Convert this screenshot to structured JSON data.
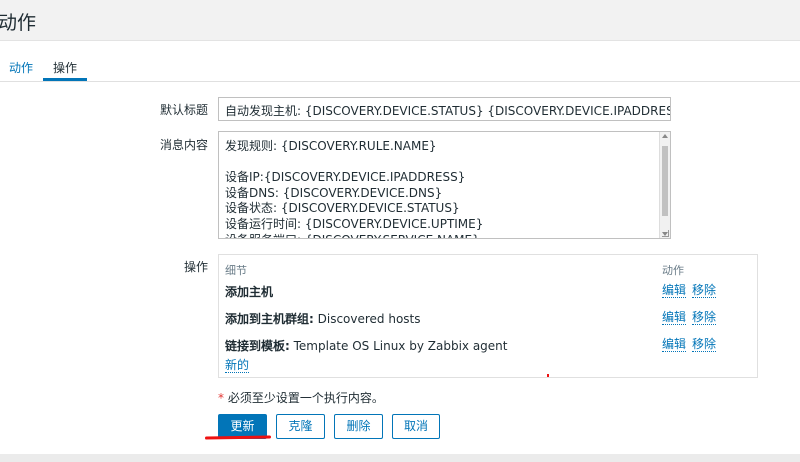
{
  "header": {
    "title": "动作"
  },
  "tabs": [
    {
      "label": "动作",
      "active": false
    },
    {
      "label": "操作",
      "active": true
    }
  ],
  "form": {
    "default_subject_label": "默认标题",
    "default_subject_value": "自动发现主机: {DISCOVERY.DEVICE.STATUS} {DISCOVERY.DEVICE.IPADDRESS}",
    "message_label": "消息内容",
    "message_lines": [
      "发现规则: {DISCOVERY.RULE.NAME}",
      "",
      "设备IP:{DISCOVERY.DEVICE.IPADDRESS}",
      "设备DNS: {DISCOVERY.DEVICE.DNS}",
      "设备状态: {DISCOVERY.DEVICE.STATUS}",
      "设备运行时间: {DISCOVERY.DEVICE.UPTIME}",
      "设备服务端口: {DISCOVERY.SERVICE.NAME}"
    ],
    "operations_label": "操作"
  },
  "operations": {
    "col_details": "细节",
    "col_action": "动作",
    "rows": [
      {
        "bold": "添加主机",
        "rest": "",
        "edit": "编辑",
        "remove": "移除"
      },
      {
        "bold": "添加到主机群组:",
        "rest": " Discovered hosts",
        "edit": "编辑",
        "remove": "移除"
      },
      {
        "bold": "链接到模板:",
        "rest": " Template OS Linux by Zabbix agent",
        "edit": "编辑",
        "remove": "移除"
      }
    ],
    "new_link": "新的"
  },
  "note": {
    "star": "*",
    "text": " 必须至少设置一个执行内容。"
  },
  "buttons": {
    "update": "更新",
    "clone": "克隆",
    "delete": "删除",
    "cancel": "取消"
  },
  "colors": {
    "accent": "#0275b8",
    "annotation": "#e11111"
  }
}
